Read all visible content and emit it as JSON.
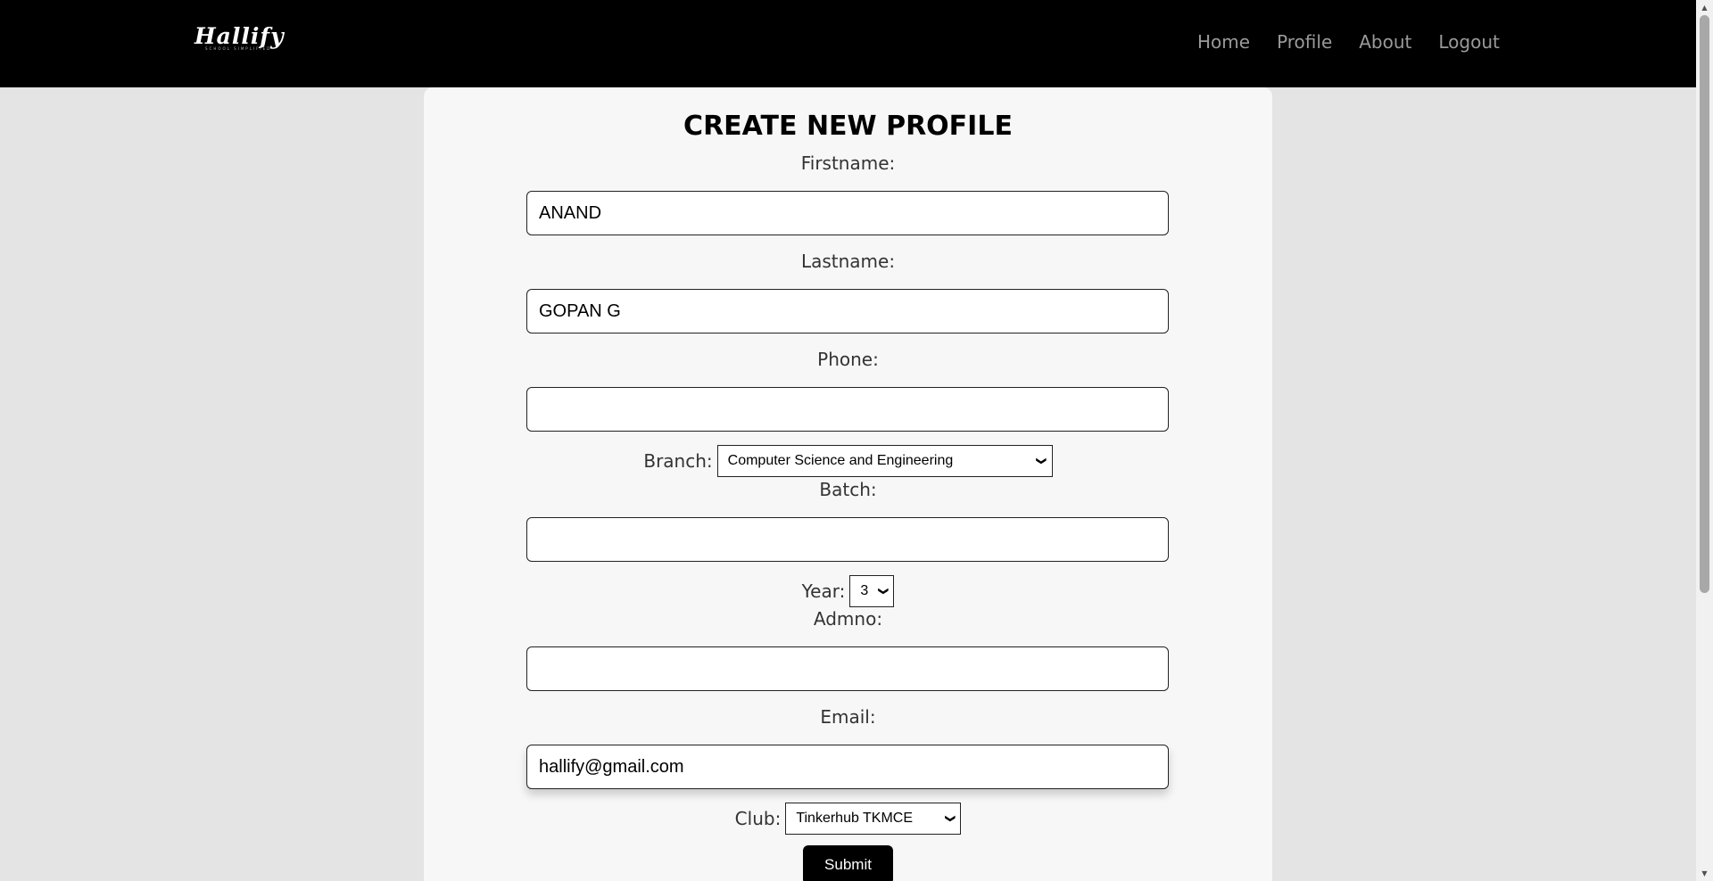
{
  "header": {
    "logo_text": "Hallify",
    "logo_tagline": "SCHOOL SIMPLIFIED",
    "nav": [
      {
        "label": "Home"
      },
      {
        "label": "Profile"
      },
      {
        "label": "About"
      },
      {
        "label": "Logout"
      }
    ]
  },
  "form": {
    "title": "CREATE NEW PROFILE",
    "firstname": {
      "label": "Firstname:",
      "value": "ANAND"
    },
    "lastname": {
      "label": "Lastname:",
      "value": "GOPAN G"
    },
    "phone": {
      "label": "Phone:",
      "value": ""
    },
    "branch": {
      "label": "Branch:",
      "selected": "Computer Science and Engineering"
    },
    "batch": {
      "label": "Batch:",
      "value": ""
    },
    "year": {
      "label": "Year:",
      "selected": "3"
    },
    "admno": {
      "label": "Admno:",
      "value": ""
    },
    "email": {
      "label": "Email:",
      "value": "hallify@gmail.com"
    },
    "club": {
      "label": "Club:",
      "selected": "Tinkerhub TKMCE"
    },
    "submit_label": "Submit"
  },
  "colors": {
    "navbar_bg": "#000000",
    "page_bg": "#e4e4e4",
    "card_bg": "#f7f7f7",
    "button_bg": "#000000",
    "nav_link": "#9a9a9a"
  }
}
